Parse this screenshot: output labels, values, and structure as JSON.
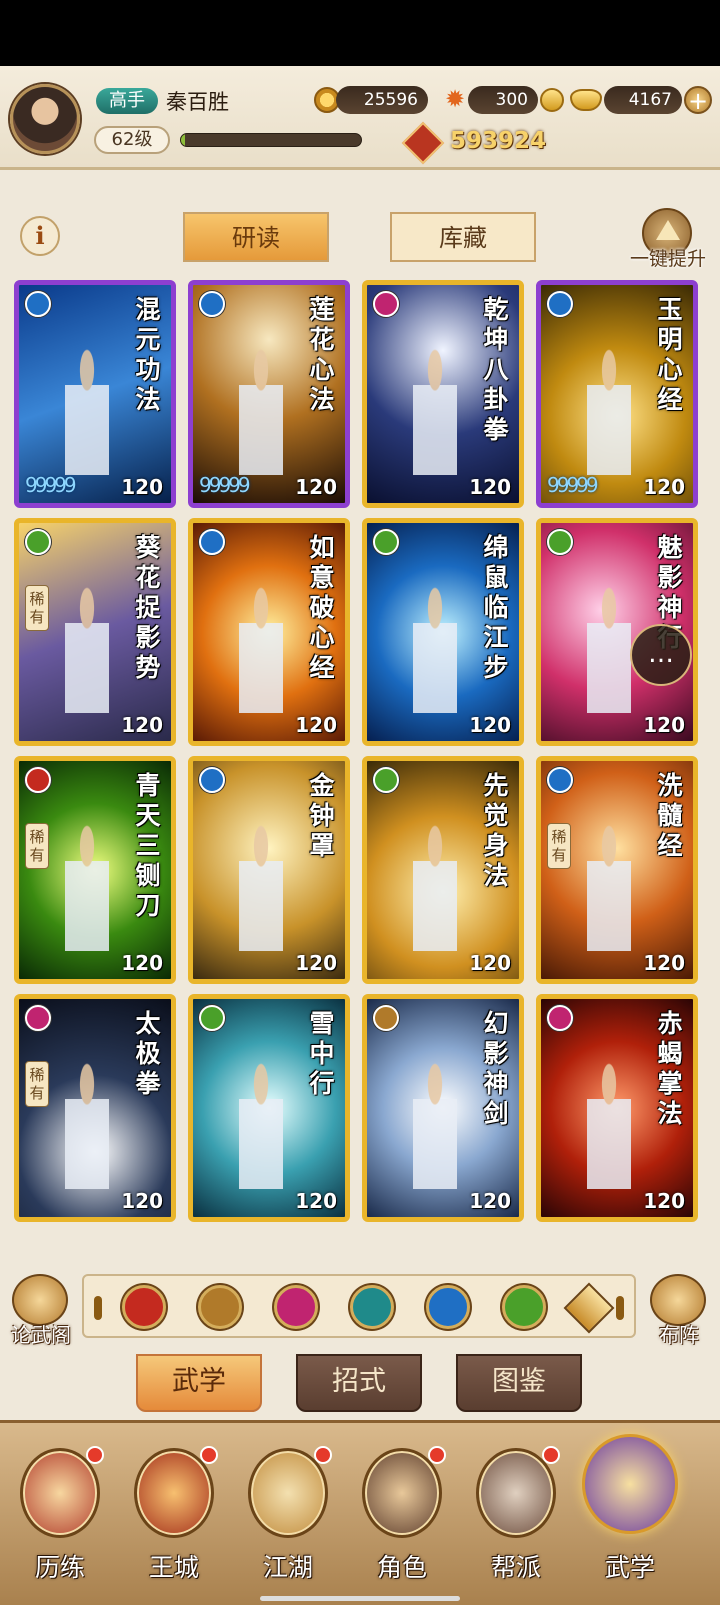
{
  "player": {
    "rank": "高手",
    "name": "秦百胜",
    "level": "62级",
    "exp_progress": 0.02,
    "power": "593924"
  },
  "currency": {
    "coins": "25596",
    "flame": "300",
    "gold": "4167"
  },
  "tabs": {
    "study": "研读",
    "storage": "库藏"
  },
  "upgrade_label": "一键提升",
  "cards": [
    {
      "title": "混元功法",
      "level": "120",
      "type": "water",
      "frame": "purple",
      "drops": "99999"
    },
    {
      "title": "莲花心法",
      "level": "120",
      "type": "water",
      "frame": "purple",
      "drops": "99999"
    },
    {
      "title": "乾坤八卦拳",
      "level": "120",
      "type": "fist",
      "frame": "gold",
      "drops": ""
    },
    {
      "title": "玉明心经",
      "level": "120",
      "type": "water",
      "frame": "purple",
      "drops": "99999"
    },
    {
      "title": "葵花捉影势",
      "level": "120",
      "type": "wind",
      "frame": "gold",
      "rarity": "稀有",
      "drops": ""
    },
    {
      "title": "如意破心经",
      "level": "120",
      "type": "water",
      "frame": "gold",
      "drops": ""
    },
    {
      "title": "绵鼠临江步",
      "level": "120",
      "type": "wind",
      "frame": "gold",
      "drops": ""
    },
    {
      "title": "魅影神行",
      "level": "120",
      "type": "wind",
      "frame": "gold",
      "drops": ""
    },
    {
      "title": "青天三铡刀",
      "level": "120",
      "type": "blade",
      "frame": "gold",
      "rarity": "稀有",
      "drops": ""
    },
    {
      "title": "金钟罩",
      "level": "120",
      "type": "water",
      "frame": "gold",
      "drops": ""
    },
    {
      "title": "先觉身法",
      "level": "120",
      "type": "wind",
      "frame": "gold",
      "drops": ""
    },
    {
      "title": "洗髓经",
      "level": "120",
      "type": "water",
      "frame": "gold",
      "rarity": "稀有",
      "drops": ""
    },
    {
      "title": "太极拳",
      "level": "120",
      "type": "fist",
      "frame": "gold",
      "rarity": "稀有",
      "drops": ""
    },
    {
      "title": "雪中行",
      "level": "120",
      "type": "wind",
      "frame": "gold",
      "drops": ""
    },
    {
      "title": "幻影神剑",
      "level": "120",
      "type": "sword",
      "frame": "gold",
      "drops": ""
    },
    {
      "title": "赤蝎掌法",
      "level": "120",
      "type": "fist",
      "frame": "gold",
      "drops": ""
    }
  ],
  "colors": {
    "blade": "#c42a1f",
    "sword": "#b07a2a",
    "fist": "#c02470",
    "palm": "#1f8a8a",
    "water": "#1f6fc4",
    "wind": "#4aa02a",
    "card_gold": "#e9b52a",
    "card_purple": "#8d3fd0"
  },
  "side": {
    "left": "论武阁",
    "right": "布阵"
  },
  "subtabs": [
    "武学",
    "招式",
    "图鉴"
  ],
  "nav": [
    {
      "label": "历练",
      "dot": true
    },
    {
      "label": "王城",
      "dot": true
    },
    {
      "label": "江湖",
      "dot": true
    },
    {
      "label": "角色",
      "dot": true
    },
    {
      "label": "帮派",
      "dot": true
    },
    {
      "label": "武学",
      "dot": false
    }
  ]
}
